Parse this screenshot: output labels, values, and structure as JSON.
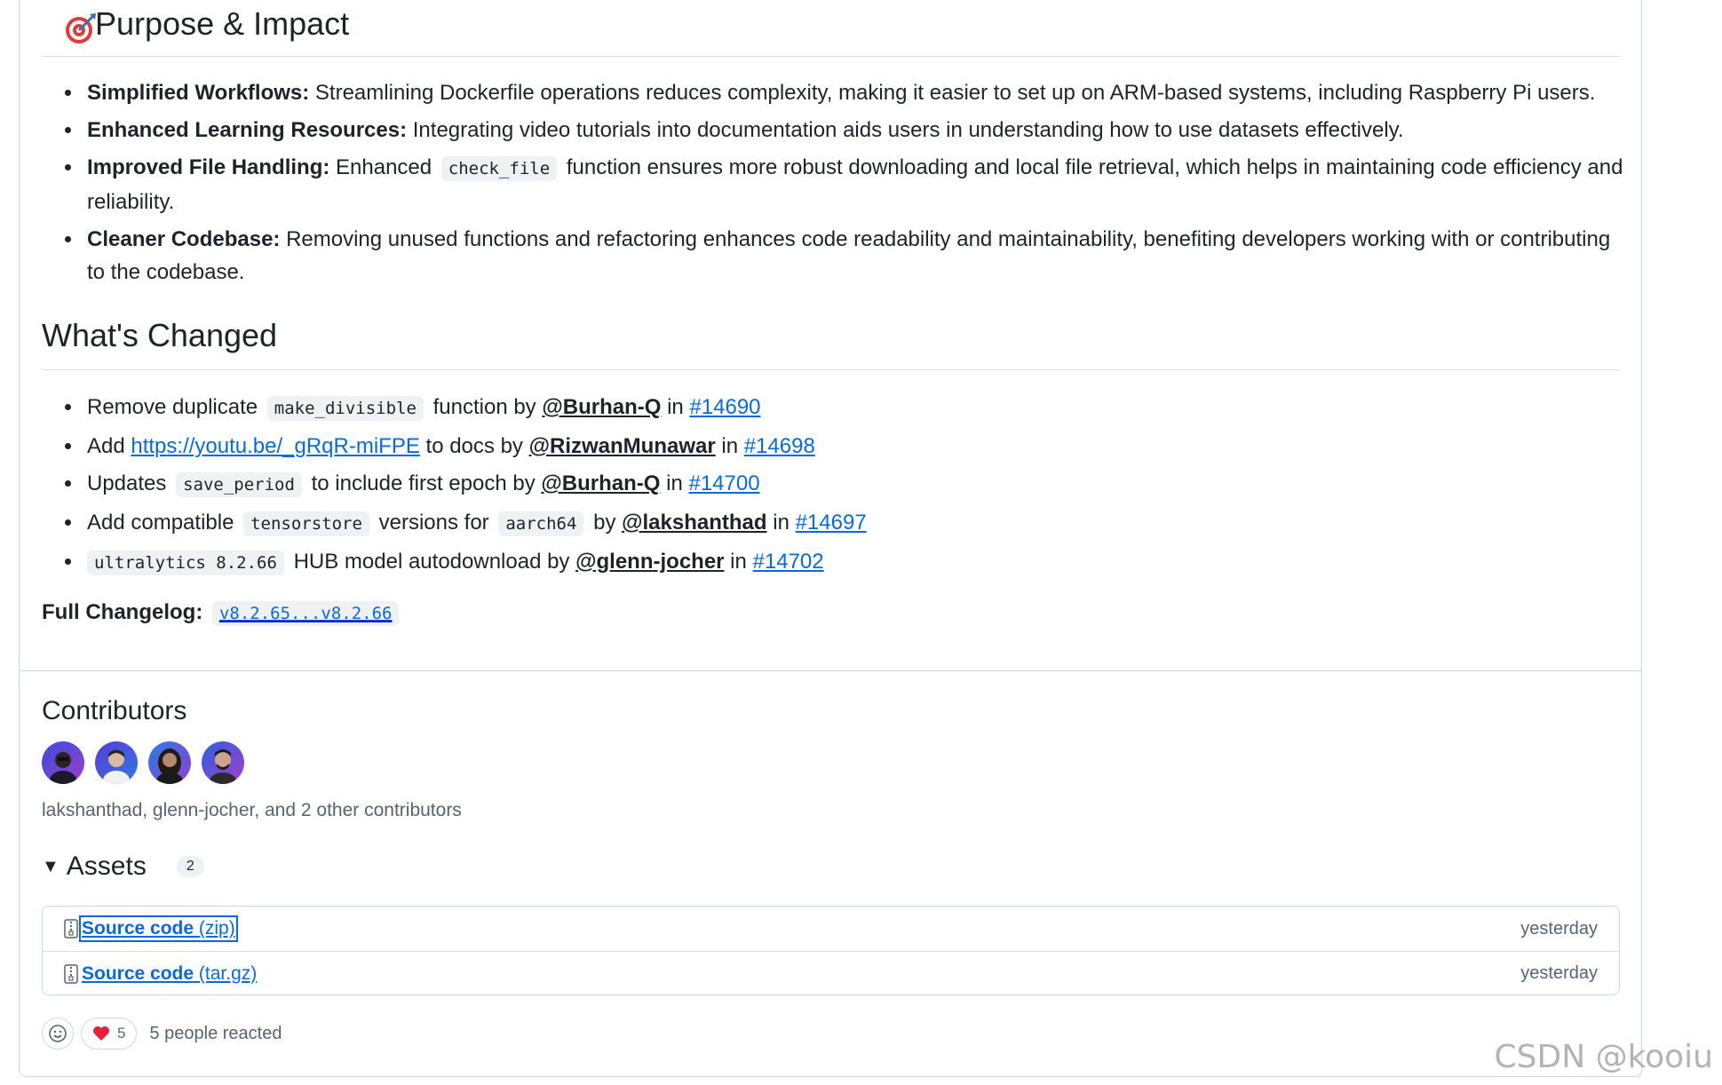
{
  "purpose": {
    "title": "Purpose & Impact",
    "items": [
      {
        "bold": "Simplified Workflows:",
        "text": " Streamlining Dockerfile operations reduces complexity, making it easier to set up on ARM-based systems, including Raspberry Pi users."
      },
      {
        "bold": "Enhanced Learning Resources:",
        "text": " Integrating video tutorials into documentation aids users in understanding how to use datasets effectively."
      },
      {
        "bold": "Improved File Handling:",
        "pre": " Enhanced ",
        "code": "check_file",
        "text": " function ensures more robust downloading and local file retrieval, which helps in maintaining code efficiency and reliability."
      },
      {
        "bold": "Cleaner Codebase:",
        "text": " Removing unused functions and refactoring enhances code readability and maintainability, benefiting developers working with or contributing to the codebase."
      }
    ]
  },
  "changed": {
    "title": "What's Changed",
    "items": [
      {
        "t1": "Remove duplicate ",
        "code": "make_divisible",
        "t2": " function by ",
        "user": "@Burhan-Q",
        "t3": " in ",
        "pr": "#14690"
      },
      {
        "t1": "Add ",
        "link": "https://youtu.be/_gRqR-miFPE",
        "t2": " to docs by ",
        "user": "@RizwanMunawar",
        "t3": " in ",
        "pr": "#14698"
      },
      {
        "t1": "Updates ",
        "code": "save_period",
        "t2": " to include first epoch by ",
        "user": "@Burhan-Q",
        "t3": " in ",
        "pr": "#14700"
      },
      {
        "t1": "Add compatible ",
        "code": "tensorstore",
        "t2": " versions for ",
        "code2": "aarch64",
        "t2b": " by ",
        "user": "@lakshanthad",
        "t3": " in ",
        "pr": "#14697"
      },
      {
        "code": "ultralytics 8.2.66",
        "t2": " HUB model autodownload by ",
        "user": "@glenn-jocher",
        "t3": " in ",
        "pr": "#14702"
      }
    ]
  },
  "full_changelog": {
    "label": "Full Changelog:",
    "link": "v8.2.65...v8.2.66"
  },
  "contributors": {
    "title": "Contributors",
    "summary": "lakshanthad, glenn-jocher, and 2 other contributors"
  },
  "assets": {
    "title": "Assets",
    "count": "2",
    "items": [
      {
        "name": "Source code",
        "ext": "(zip)",
        "date": "yesterday"
      },
      {
        "name": "Source code",
        "ext": "(tar.gz)",
        "date": "yesterday"
      }
    ]
  },
  "reactions": {
    "heart_count": "5",
    "summary": "5 people reacted"
  },
  "watermark": "CSDN @kooiu",
  "colors": {
    "link": "#0969da",
    "border": "#d0d7de",
    "muted": "#59636e"
  }
}
